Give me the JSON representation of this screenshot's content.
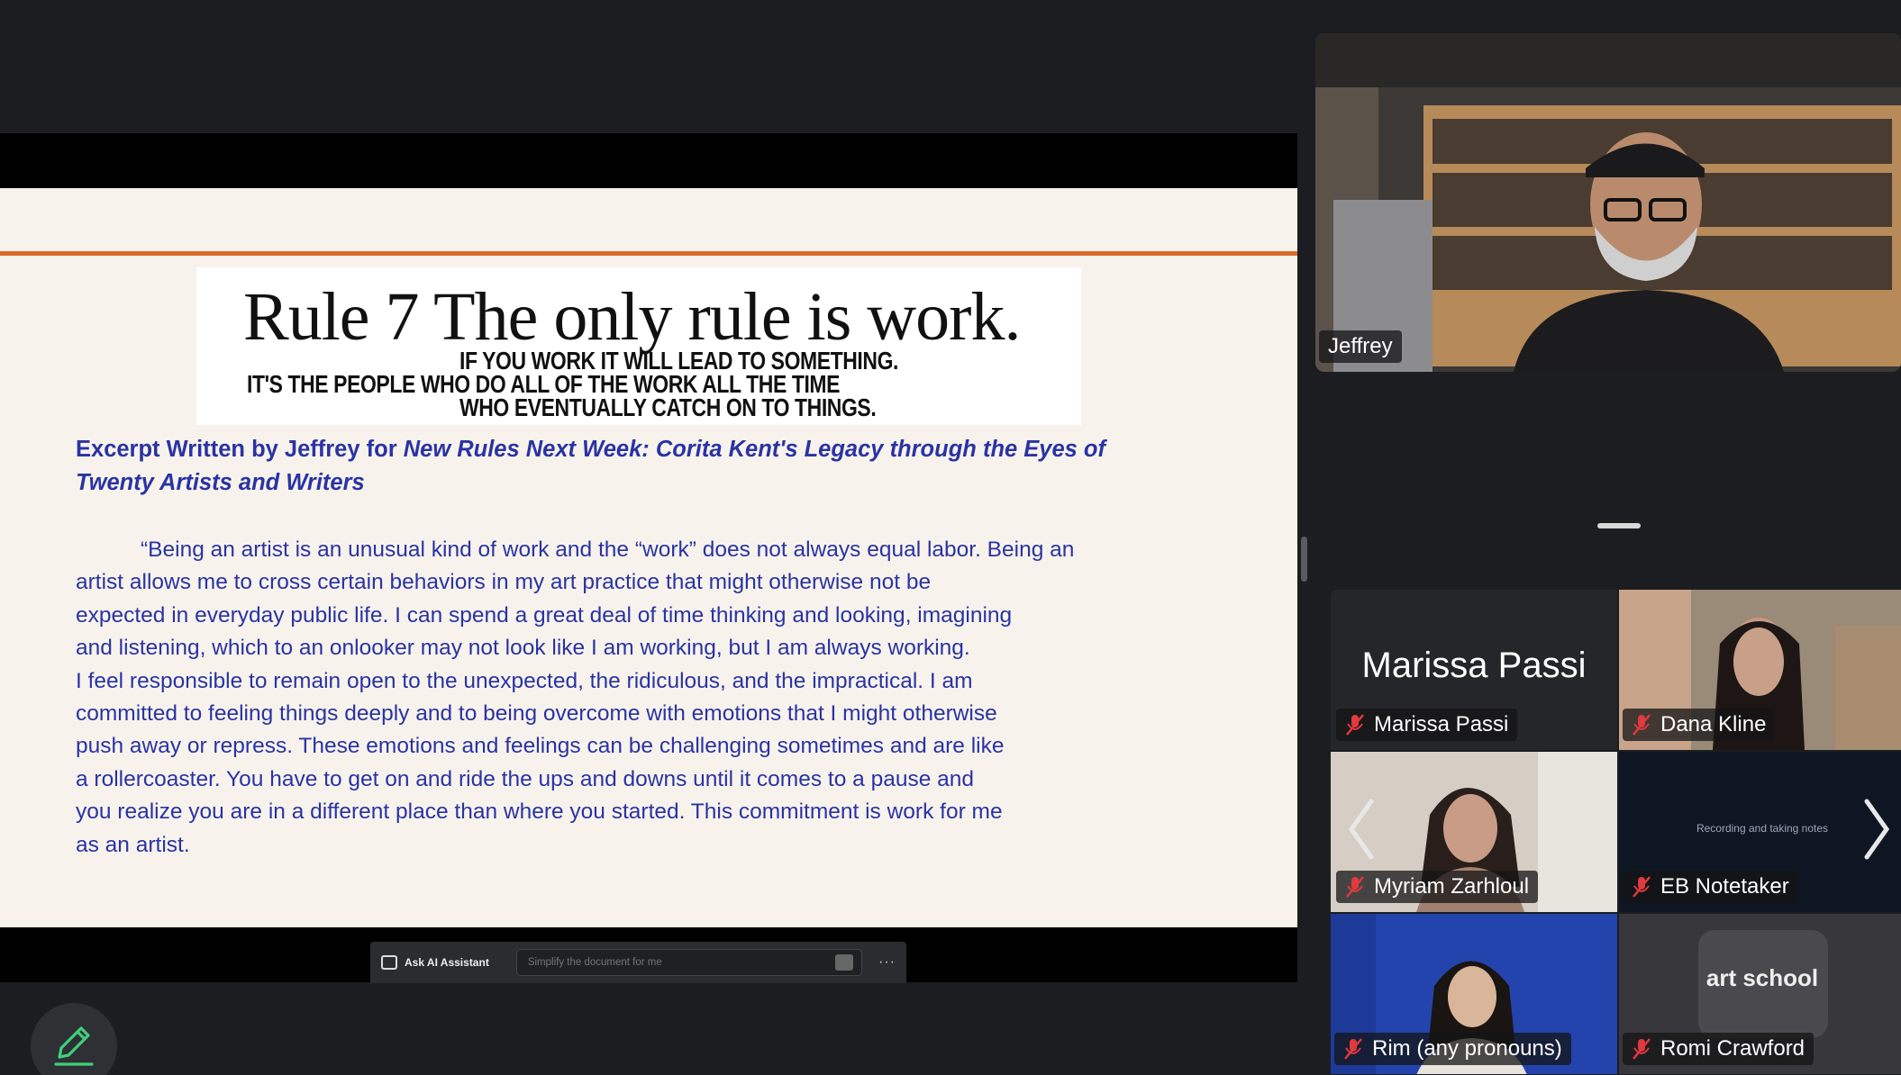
{
  "slide": {
    "rule_title": "Rule 7  The only rule is work.",
    "rule_sub1": "IF YOU WORK IT WILL LEAD TO SOMETHING.",
    "rule_sub2": "IT'S THE PEOPLE WHO DO ALL OF THE WORK ALL THE TIME",
    "rule_sub3": "WHO EVENTUALLY CATCH ON TO THINGS.",
    "heading_prefix": "Excerpt Written by Jeffrey for ",
    "heading_title": "New Rules Next Week: Corita Kent's Legacy through the Eyes of Twenty Artists and Writers",
    "body_lines": [
      "“Being an artist is an unusual kind of work and the “work” does not always equal labor. Being an",
      "artist allows me to cross certain behaviors in my art practice that might otherwise not be",
      "expected in everyday public life. I can spend a great deal of time thinking and looking, imagining",
      "and listening, which to an onlooker may not look like I am working, but I am always working.",
      "I feel responsible to remain open to the unexpected, the ridiculous, and the impractical. I am",
      "committed to feeling things deeply and to being overcome with emotions that I might otherwise",
      "push away or repress. These emotions and feelings can be challenging sometimes and are like",
      "a rollercoaster. You have to get on and ride the ups and downs until it comes to a pause and",
      "you realize you are in a different place than where you started. This commitment is work for me",
      "as an artist."
    ]
  },
  "ai_bar": {
    "label": "Ask AI Assistant",
    "placeholder": "Simplify the document for me",
    "more": "···"
  },
  "speaker": {
    "name": "Jeffrey"
  },
  "gallery": {
    "marissa_display": "Marissa Passi",
    "marissa": "Marissa Passi",
    "dana": "Dana Kline",
    "myriam": "Myriam Zarhloul",
    "eb": "EB Notetaker",
    "eb_text": "Recording and taking notes",
    "rim": "Rim (any pronouns)",
    "romi": "Romi Crawford",
    "romi_logo": "art school"
  },
  "colors": {
    "accent_orange": "#d96b2e",
    "slide_text_blue": "#2a33a3",
    "annotate_green": "#3ecf7a",
    "muted_red": "#e0393e"
  }
}
